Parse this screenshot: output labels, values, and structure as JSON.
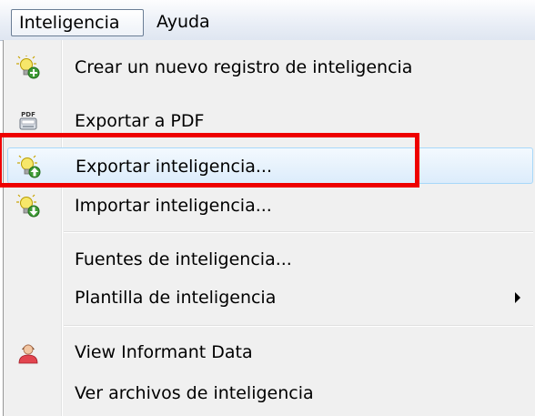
{
  "menubar": {
    "items": [
      {
        "label": "Inteligencia"
      },
      {
        "label": "Ayuda"
      }
    ]
  },
  "menu": {
    "items": [
      {
        "label": "Crear un nuevo registro de inteligencia",
        "icon": "bulb-add-icon"
      },
      {
        "label": "Exportar a PDF",
        "icon": "pdf-icon"
      },
      {
        "label": "Exportar inteligencia...",
        "icon": "bulb-export-icon",
        "highlighted": true
      },
      {
        "label": "Importar inteligencia...",
        "icon": "bulb-import-icon"
      },
      {
        "label": "Fuentes de inteligencia..."
      },
      {
        "label": "Plantilla de inteligencia",
        "has_submenu": true
      },
      {
        "label": "View Informant Data",
        "icon": "person-icon"
      },
      {
        "label": "Ver archivos de inteligencia"
      }
    ]
  },
  "icon_text": {
    "pdf": "PDF"
  },
  "colors": {
    "annotation": "#ee0000",
    "highlight_border": "#a8d8f9",
    "menu_background": "#f0f0f0"
  }
}
